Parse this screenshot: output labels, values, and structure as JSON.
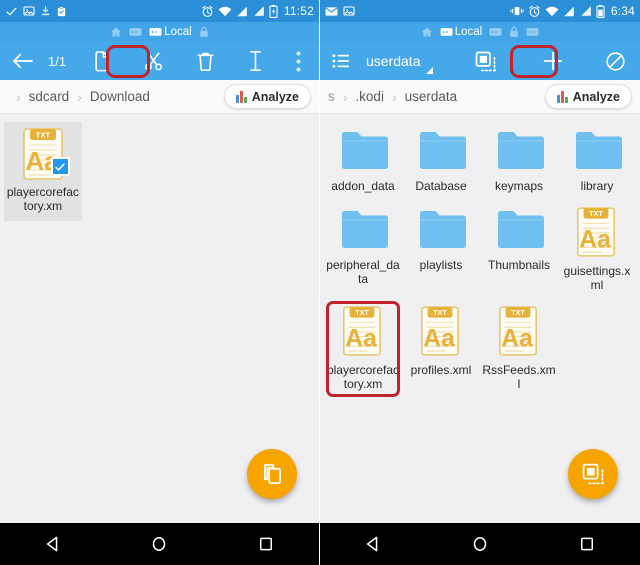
{
  "left": {
    "statusbar": {
      "icons": [
        "check-icon",
        "image-icon",
        "download-icon",
        "clipboard-icon"
      ],
      "right_icons": [
        "alarm-icon",
        "wifi-icon",
        "signal-icon",
        "signal-roaming-icon",
        "battery-icon"
      ],
      "time": "11:52"
    },
    "tabs": [
      {
        "name": "home-tab",
        "label": "",
        "icon": "home-icon",
        "active": false
      },
      {
        "name": "monitor-tab",
        "label": "",
        "icon": "monitor-icon",
        "active": false
      },
      {
        "name": "local-tab",
        "label": "Local",
        "icon": "monitor-icon",
        "active": true
      },
      {
        "name": "lock-tab",
        "label": "",
        "icon": "lock-icon",
        "active": false
      }
    ],
    "toolbar": {
      "back_icon": "back-arrow-icon",
      "count": "1/1",
      "copy_icon": "copy-icon",
      "cut_icon": "scissors-icon",
      "delete_icon": "trash-icon",
      "rename_icon": "text-cursor-icon",
      "overflow_icon": "more-vertical-icon",
      "highlighted": "copy-button"
    },
    "breadcrumb": {
      "items": [
        "",
        "sdcard",
        "Download"
      ],
      "analyze_label": "Analyze",
      "analyze_icon": "bar-chart-icon",
      "bar_colors": [
        "#4a90d9",
        "#e05b4b",
        "#5aa85a"
      ]
    },
    "files": [
      {
        "name": "playercorefactory.xm",
        "type": "file",
        "ext_label": "TXT",
        "selected": true,
        "highlighted": false
      }
    ],
    "fab": {
      "icon": "copy-icon",
      "color": "#f7a400"
    },
    "nav": [
      "back-triangle-icon",
      "home-circle-icon",
      "recents-square-icon"
    ]
  },
  "right": {
    "statusbar": {
      "icons": [
        "mail-icon",
        "image-icon"
      ],
      "right_icons": [
        "vibrate-icon",
        "alarm-icon",
        "wifi-icon",
        "signal-icon",
        "signal-roaming-icon",
        "battery-icon"
      ],
      "time": "6:34"
    },
    "tabs": [
      {
        "name": "home-tab",
        "label": "",
        "icon": "home-icon",
        "active": false
      },
      {
        "name": "local-tab",
        "label": "Local",
        "icon": "monitor-icon",
        "active": true
      },
      {
        "name": "monitor-tab",
        "label": "",
        "icon": "monitor-icon",
        "active": false
      },
      {
        "name": "lock-tab",
        "label": "",
        "icon": "lock-icon",
        "active": false
      },
      {
        "name": "monitor2-tab",
        "label": "",
        "icon": "monitor-icon",
        "active": false
      }
    ],
    "toolbar": {
      "menu_icon": "list-icon",
      "title": "userdata",
      "sort_icon": "sort-triangle-icon",
      "paste_icon": "paste-icon",
      "add_icon": "plus-icon",
      "cancel_icon": "ban-icon",
      "highlighted": "paste-button"
    },
    "breadcrumb": {
      "items": [
        "s",
        ".kodi",
        "userdata"
      ],
      "analyze_label": "Analyze",
      "analyze_icon": "bar-chart-icon",
      "bar_colors": [
        "#4a90d9",
        "#e05b4b",
        "#5aa85a"
      ]
    },
    "files": [
      {
        "name": "addon_data",
        "type": "folder",
        "ext_label": "",
        "selected": false,
        "highlighted": false
      },
      {
        "name": "Database",
        "type": "folder",
        "ext_label": "",
        "selected": false,
        "highlighted": false
      },
      {
        "name": "keymaps",
        "type": "folder",
        "ext_label": "",
        "selected": false,
        "highlighted": false
      },
      {
        "name": "library",
        "type": "folder",
        "ext_label": "",
        "selected": false,
        "highlighted": false
      },
      {
        "name": "peripheral_data",
        "type": "folder",
        "ext_label": "",
        "selected": false,
        "highlighted": false
      },
      {
        "name": "playlists",
        "type": "folder",
        "ext_label": "",
        "selected": false,
        "highlighted": false
      },
      {
        "name": "Thumbnails",
        "type": "folder",
        "ext_label": "",
        "selected": false,
        "highlighted": false
      },
      {
        "name": "guisettings.xml",
        "type": "file",
        "ext_label": "TXT",
        "selected": false,
        "highlighted": false
      },
      {
        "name": "playercorefactory.xm",
        "type": "file",
        "ext_label": "TXT",
        "selected": false,
        "highlighted": true
      },
      {
        "name": "profiles.xml",
        "type": "file",
        "ext_label": "TXT",
        "selected": false,
        "highlighted": false
      },
      {
        "name": "RssFeeds.xml",
        "type": "file",
        "ext_label": "TXT",
        "selected": false,
        "highlighted": false
      }
    ],
    "fab": {
      "icon": "paste-icon",
      "color": "#f7a400"
    },
    "nav": [
      "back-triangle-icon",
      "home-circle-icon",
      "recents-square-icon"
    ]
  },
  "colors": {
    "status_blue": "#2b8fd8",
    "toolbar_blue": "#45a8e9",
    "tabstrip_blue": "#41a5e8",
    "folder_blue": "#6fc0f0",
    "file_gold": "#e8b23a",
    "accent_orange": "#f7a400",
    "highlight_red": "#c0232b",
    "page_bg": "#f0f0f2"
  }
}
